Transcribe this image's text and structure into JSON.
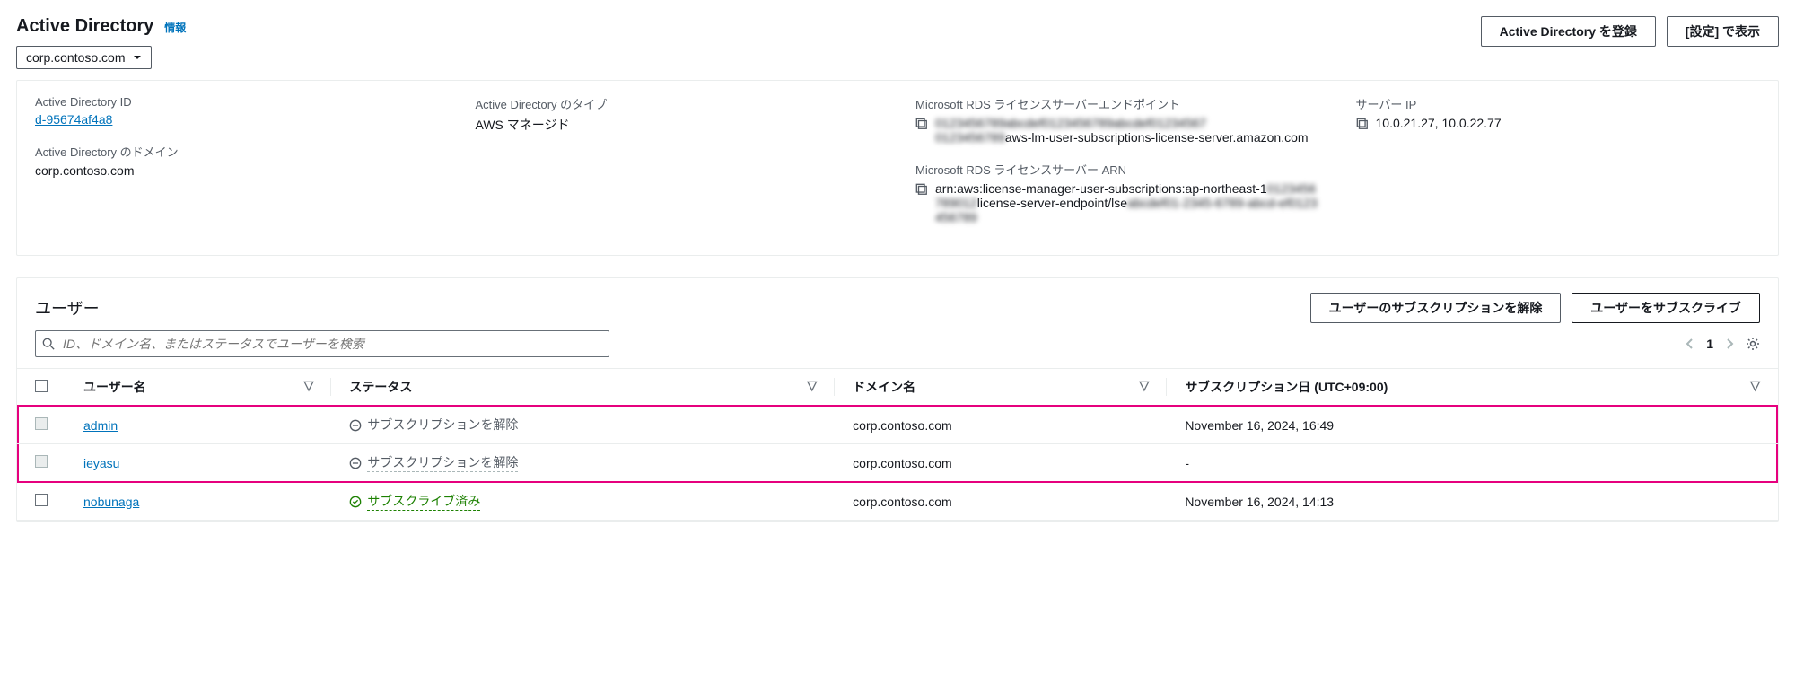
{
  "header": {
    "title": "Active Directory",
    "info_link": "情報",
    "register_btn": "Active Directory を登録",
    "settings_btn": "[設定] で表示",
    "domain_dropdown": "corp.contoso.com"
  },
  "details": {
    "col1": {
      "id_label": "Active Directory ID",
      "id_value": "d-95674af4a8",
      "domain_label": "Active Directory のドメイン",
      "domain_value": "corp.contoso.com"
    },
    "col2": {
      "type_label": "Active Directory のタイプ",
      "type_value": "AWS マネージド"
    },
    "col3": {
      "endpoint_label": "Microsoft RDS ライセンスサーバーエンドポイント",
      "endpoint_blur1": "0123456789abcdef0123456789abcdef01234567",
      "endpoint_blur2": "0123456789",
      "endpoint_suffix": "aws-lm-user-subscriptions-license-server.amazon.com",
      "arn_label": "Microsoft RDS ライセンスサーバー ARN",
      "arn_prefix": "arn:aws:license-manager-user-subscriptions:ap-northeast-1",
      "arn_blur1": "0123456789012",
      "arn_mid": "license-server-endpoint/lse",
      "arn_blur2": "abcdef01-2345-6789-abcd-ef0123456789"
    },
    "col4": {
      "ip_label": "サーバー IP",
      "ip_value": "10.0.21.27, 10.0.22.77"
    }
  },
  "users": {
    "section_title": "ユーザー",
    "unsubscribe_btn": "ユーザーのサブスクリプションを解除",
    "subscribe_btn": "ユーザーをサブスクライブ",
    "search_placeholder": "ID、ドメイン名、またはステータスでユーザーを検索",
    "page": "1",
    "columns": {
      "username": "ユーザー名",
      "status": "ステータス",
      "domain": "ドメイン名",
      "sub_date": "サブスクリプション日 (UTC+09:00)"
    },
    "status_labels": {
      "unsubscribed": "サブスクリプションを解除",
      "subscribed": "サブスクライブ済み"
    },
    "rows": [
      {
        "username": "admin",
        "status": "unsubscribed",
        "domain": "corp.contoso.com",
        "date": "November 16, 2024, 16:49",
        "selectable": false,
        "highlight": true
      },
      {
        "username": "ieyasu",
        "status": "unsubscribed",
        "domain": "corp.contoso.com",
        "date": "-",
        "selectable": false,
        "highlight": true
      },
      {
        "username": "nobunaga",
        "status": "subscribed",
        "domain": "corp.contoso.com",
        "date": "November 16, 2024, 14:13",
        "selectable": true,
        "highlight": false
      }
    ]
  }
}
